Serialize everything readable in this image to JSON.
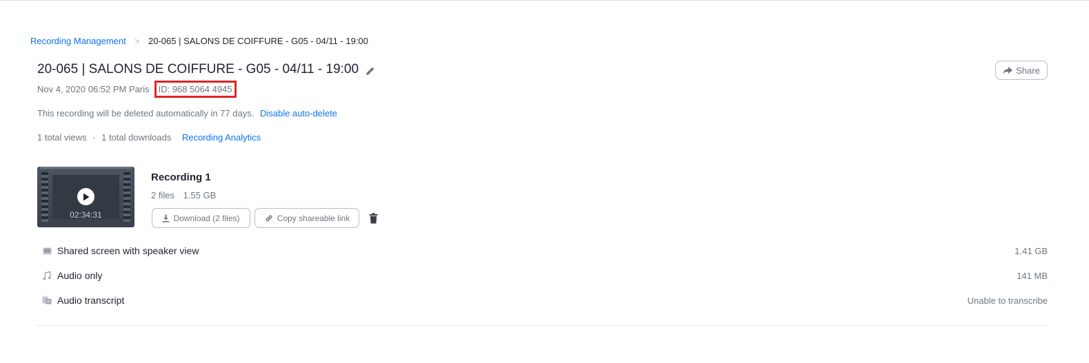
{
  "breadcrumb": {
    "root": "Recording Management",
    "separator": ">",
    "current": "20-065 | SALONS DE COIFFURE - G05 - 04/11 - 19:00"
  },
  "meeting": {
    "title": "20-065 | SALONS DE COIFFURE - G05 - 04/11 - 19:00",
    "datetime": "Nov 4, 2020 06:52 PM Paris",
    "id_label": "ID: 968 5064 4945"
  },
  "share": {
    "label": "Share"
  },
  "autodelete": {
    "text": "This recording will be deleted automatically in 77 days.",
    "link": "Disable auto-delete"
  },
  "stats": {
    "views": "1 total views",
    "separator": "·",
    "downloads": "1 total downloads",
    "analytics_link": "Recording Analytics"
  },
  "recording": {
    "title": "Recording 1",
    "file_count": "2 files",
    "total_size": "1.55 GB",
    "duration": "02:34:31",
    "download_label": "Download (2 files)",
    "copy_link_label": "Copy shareable link"
  },
  "files": [
    {
      "icon": "screen-share-icon",
      "name": "Shared screen with speaker view",
      "size": "1.41 GB"
    },
    {
      "icon": "music-note-icon",
      "name": "Audio only",
      "size": "141 MB"
    },
    {
      "icon": "transcript-icon",
      "name": "Audio transcript",
      "size": "Unable to transcribe"
    }
  ],
  "colors": {
    "link": "#0e72ed",
    "text_primary": "#232333",
    "text_secondary": "#6e7680",
    "highlight_box": "#e02424",
    "button_border": "#babacc"
  }
}
